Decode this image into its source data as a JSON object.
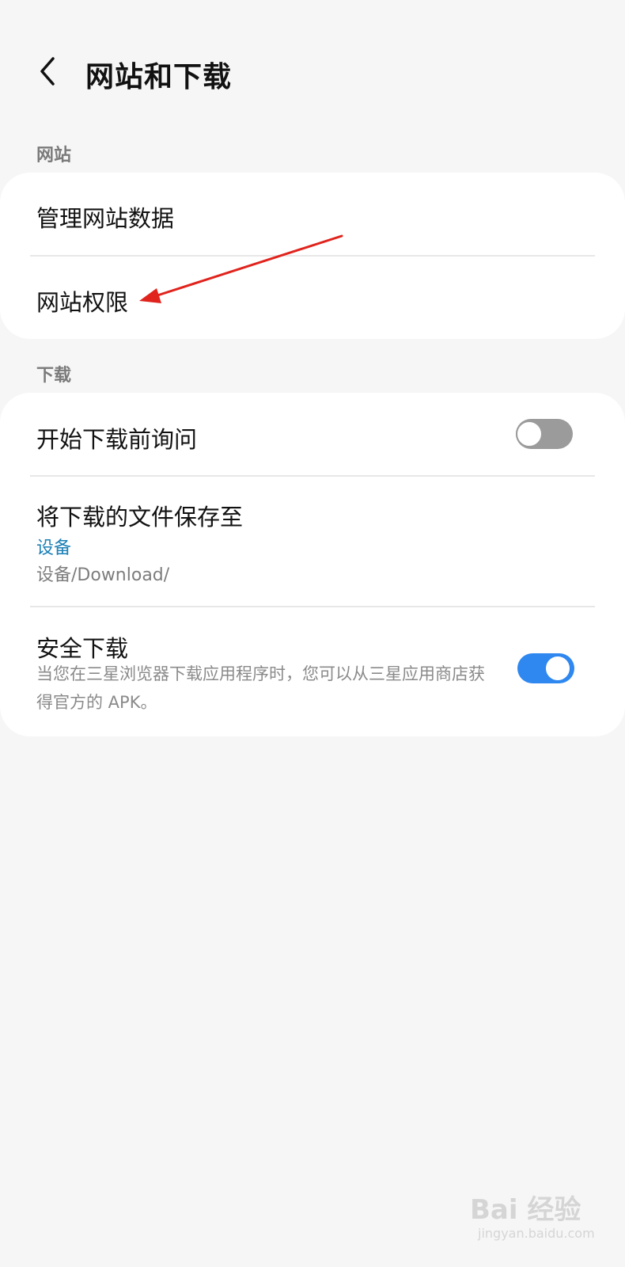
{
  "header": {
    "back_icon": "chevron-left-icon",
    "title": "网站和下载"
  },
  "sections": {
    "website": {
      "header": "网站",
      "items": [
        {
          "title": "管理网站数据"
        },
        {
          "title": "网站权限"
        }
      ]
    },
    "download": {
      "header": "下载",
      "ask_before": {
        "title": "开始下载前询问",
        "toggle_on": false
      },
      "save_location": {
        "title": "将下载的文件保存至",
        "value": "设备",
        "path": "设备/Download/"
      },
      "safe_download": {
        "title": "安全下载",
        "description": "当您在三星浏览器下载应用程序时，您可以从三星应用商店获得官方的 APK。",
        "toggle_on": true
      }
    }
  },
  "colors": {
    "background": "#f6f6f6",
    "card": "#ffffff",
    "accent": "#1a7fb6",
    "toggle_on": "#2f87f0",
    "toggle_off": "#9b9b9b",
    "annotation_arrow": "#e0231c"
  },
  "watermark": {
    "main": "Bai 经验",
    "sub": "jingyan.baidu.com"
  }
}
